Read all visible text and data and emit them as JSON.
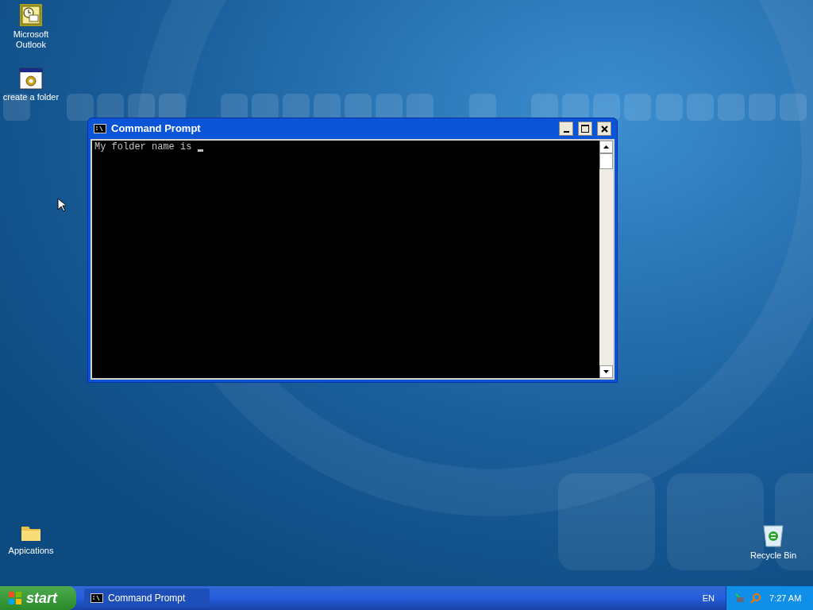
{
  "desktop_icons": [
    {
      "kind": "outlook",
      "label": "Microsoft Outlook",
      "selected": false
    },
    {
      "kind": "program",
      "label": "create a folder",
      "selected": false
    },
    {
      "kind": "folder",
      "label": "Appications",
      "selected": false
    },
    {
      "kind": "recycle",
      "label": "Recycle Bin",
      "selected": false
    }
  ],
  "window": {
    "title": "Command Prompt",
    "console_lines": [
      "My folder name is "
    ],
    "cursor": true
  },
  "taskbar": {
    "start": "start",
    "tasks": [
      {
        "label": "Command Prompt",
        "selected": true
      }
    ],
    "language": "EN",
    "clock": "7:27 AM"
  }
}
